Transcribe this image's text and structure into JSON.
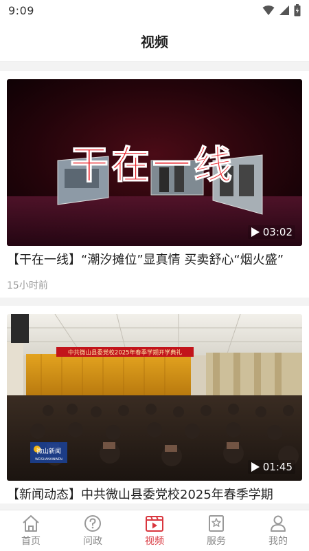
{
  "status": {
    "time": "9:09"
  },
  "header": {
    "title": "视频"
  },
  "videos": [
    {
      "thumb_text": "干在一线",
      "duration": "03:02",
      "title": "【干在一线】“潮汐摊位”显真情  买卖舒心“烟火盛”",
      "time": "15小时前"
    },
    {
      "banner_text": "中共微山县委党校2025年春季学期开学典礼",
      "logo_text": "微山新闻",
      "logo_sub": "WEISHANXINWEN",
      "duration": "01:45",
      "title": "【新闻动态】中共微山县委党校2025年春季学期"
    }
  ],
  "nav": [
    {
      "label": "首页",
      "icon": "home-icon"
    },
    {
      "label": "问政",
      "icon": "question-icon"
    },
    {
      "label": "视频",
      "icon": "video-icon",
      "active": true
    },
    {
      "label": "服务",
      "icon": "star-bookmark-icon"
    },
    {
      "label": "我的",
      "icon": "user-icon"
    }
  ],
  "colors": {
    "accent": "#d9363e",
    "inactive": "#888888"
  }
}
